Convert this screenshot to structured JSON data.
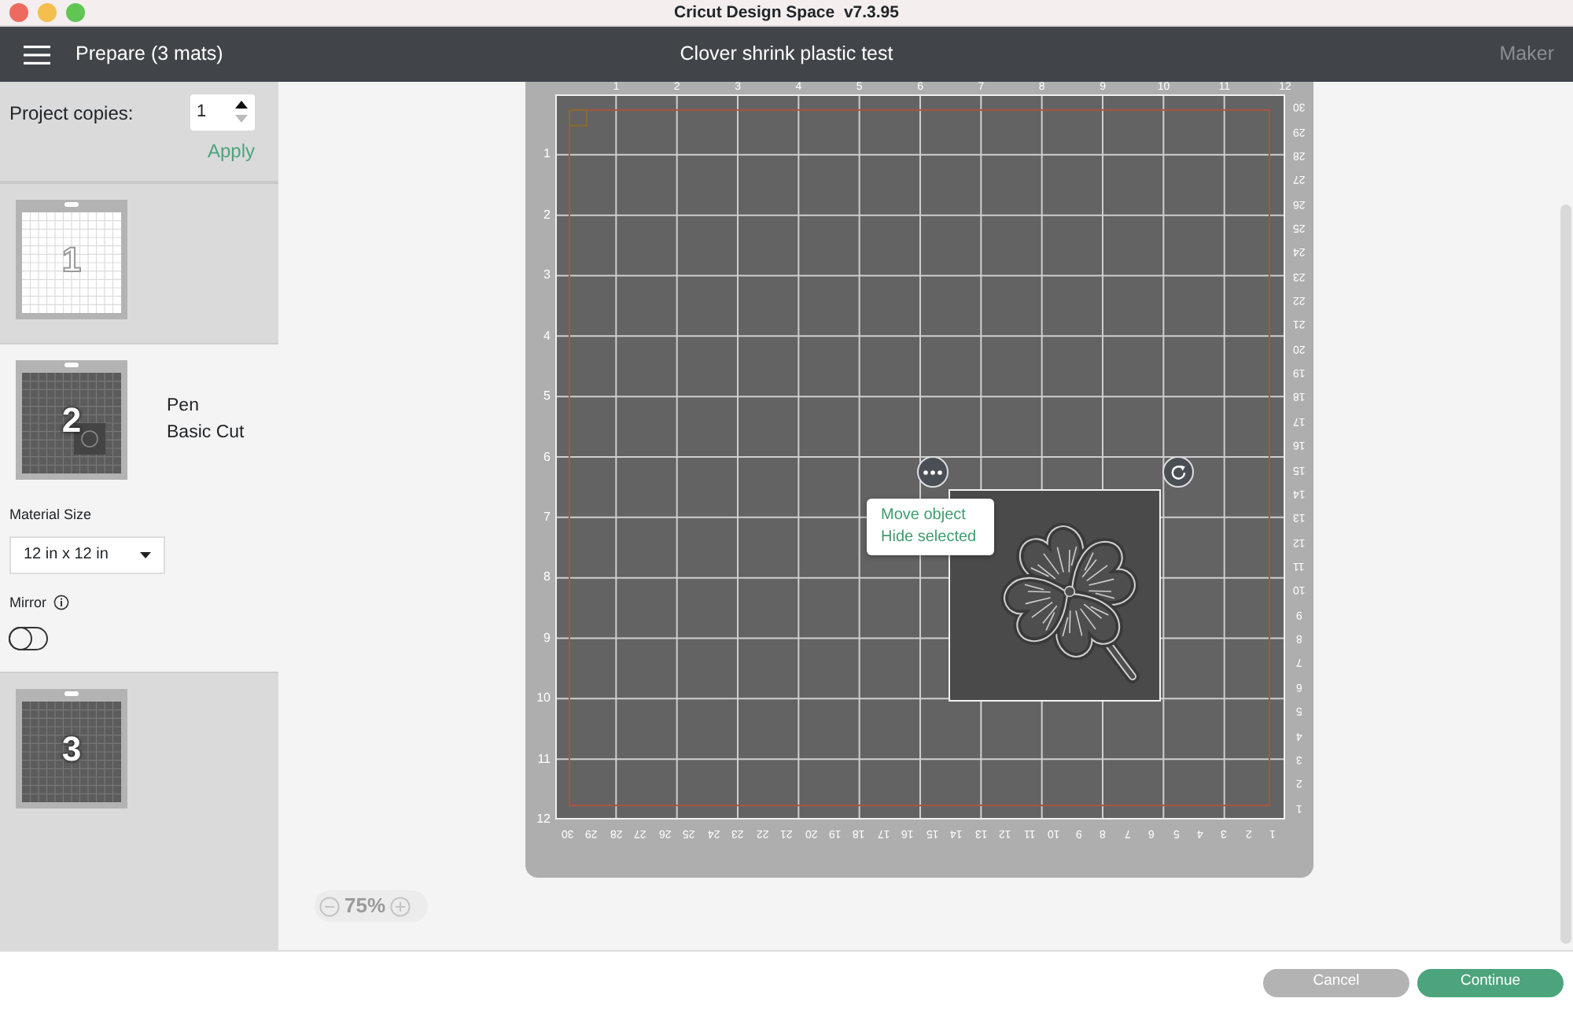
{
  "window": {
    "title": "Cricut Design Space  v7.3.95"
  },
  "header": {
    "title": "Prepare (3 mats)",
    "project": "Clover shrink plastic test",
    "machine": "Maker"
  },
  "sidebar": {
    "copies_label": "Project copies:",
    "copies_value": "1",
    "apply": "Apply",
    "mats": [
      {
        "number": "1",
        "kind": "light",
        "selected": false,
        "has_design": false
      },
      {
        "number": "2",
        "kind": "dark",
        "selected": true,
        "has_design": true,
        "lines": [
          "Pen",
          "Basic Cut"
        ],
        "material_size_label": "Material Size",
        "material_size": "12 in x 12 in",
        "mirror_label": "Mirror",
        "mirror_on": false
      },
      {
        "number": "3",
        "kind": "dark",
        "selected": false,
        "has_design": false
      }
    ]
  },
  "canvas": {
    "top_ruler": [
      "1",
      "2",
      "3",
      "4",
      "5",
      "6",
      "7",
      "8",
      "9",
      "10",
      "11",
      "12"
    ],
    "left_ruler": [
      "1",
      "2",
      "3",
      "4",
      "5",
      "6",
      "7",
      "8",
      "9",
      "10",
      "11",
      "12"
    ],
    "right_ruler": [
      "30",
      "29",
      "28",
      "27",
      "26",
      "25",
      "24",
      "23",
      "22",
      "21",
      "20",
      "19",
      "18",
      "17",
      "16",
      "15",
      "14",
      "13",
      "12",
      "11",
      "10",
      "9",
      "8",
      "7",
      "6",
      "5",
      "4",
      "3",
      "2",
      "1"
    ],
    "bottom_ruler": [
      "30",
      "29",
      "28",
      "27",
      "26",
      "25",
      "24",
      "23",
      "22",
      "21",
      "20",
      "19",
      "18",
      "17",
      "16",
      "15",
      "14",
      "13",
      "12",
      "11",
      "10",
      "9",
      "8",
      "7",
      "6",
      "5",
      "4",
      "3",
      "2",
      "1"
    ],
    "context_menu": [
      "Move object",
      "Hide selected"
    ],
    "zoom": "75%"
  },
  "footer": {
    "buttons": [
      {
        "label": "Cancel",
        "kind": "secondary"
      },
      {
        "label": "Continue",
        "kind": "primary"
      }
    ]
  }
}
